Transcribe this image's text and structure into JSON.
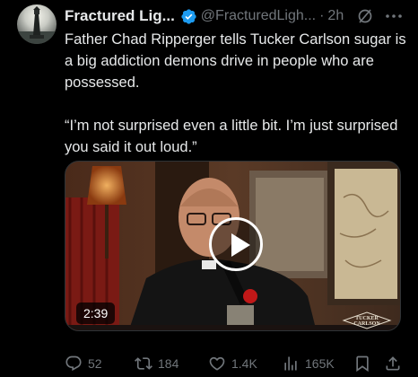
{
  "tweet": {
    "display_name": "Fractured Lig...",
    "handle": "@FracturedLigh...",
    "separator": "·",
    "time": "2h",
    "verified": true,
    "text_line_1": "Father Chad Ripperger tells Tucker Carlson sugar is a big addiction demons drive in people who are possessed.",
    "text_line_2": "“I’m not surprised even a little bit. I’m just surprised you said it out loud.”"
  },
  "media": {
    "duration": "2:39",
    "watermark": "THE TUCKER CARLSON SHOW"
  },
  "actions": {
    "replies": "52",
    "reposts": "184",
    "likes": "1.4K",
    "views": "165K"
  },
  "colors": {
    "background": "#000000",
    "text": "#e7e9ea",
    "secondary": "#71767b",
    "verified": "#1d9bf0"
  },
  "icons": [
    "grok-icon",
    "more-icon",
    "verified-badge-icon",
    "play-icon",
    "reply-icon",
    "repost-icon",
    "like-icon",
    "views-icon",
    "bookmark-icon",
    "share-icon"
  ]
}
